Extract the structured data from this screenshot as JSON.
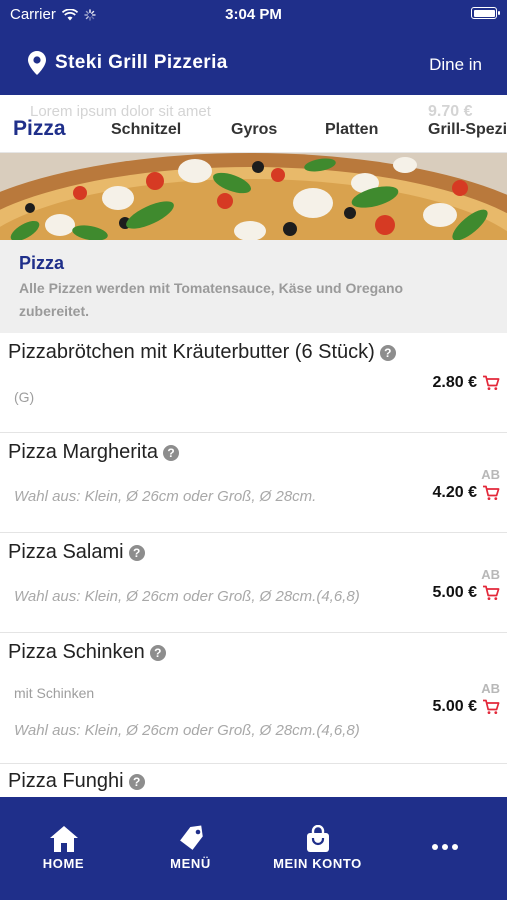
{
  "status_bar": {
    "carrier": "Carrier",
    "time": "3:04 PM"
  },
  "header": {
    "title": "Steki Grill Pizzeria",
    "mode": "Dine in"
  },
  "tabs": {
    "ghost_text": "Lorem ipsum dolor sit amet",
    "ghost_price": "9.70 €",
    "items": [
      {
        "label": "Pizza",
        "active": true
      },
      {
        "label": "Schnitzel"
      },
      {
        "label": "Gyros"
      },
      {
        "label": "Platten"
      },
      {
        "label": "Grill-Spezi"
      }
    ]
  },
  "category": {
    "title": "Pizza",
    "description": "Alle Pizzen werden mit Tomatensauce, Käse und Oregano zubereitet."
  },
  "items": [
    {
      "name": "Pizzabrötchen mit Kräuterbutter (6 Stück)",
      "sub": "(G)",
      "note": "",
      "ab": "",
      "price": "2.80 €"
    },
    {
      "name": "Pizza Margherita",
      "sub": "",
      "note": "Wahl aus: Klein, Ø 26cm oder Groß, Ø 28cm.",
      "ab": "AB",
      "price": "4.20 €"
    },
    {
      "name": "Pizza Salami",
      "sub": "",
      "note": "Wahl aus: Klein, Ø 26cm oder Groß, Ø 28cm.(4,6,8)",
      "ab": "AB",
      "price": "5.00 €"
    },
    {
      "name": "Pizza Schinken",
      "sub": "mit Schinken",
      "note": "Wahl aus: Klein, Ø 26cm oder Groß, Ø 28cm.(4,6,8)",
      "ab": "AB",
      "price": "5.00 €"
    },
    {
      "name": "Pizza Funghi",
      "sub": "",
      "note": "",
      "ab": "",
      "price": ""
    }
  ],
  "bottom_nav": [
    {
      "label": "HOME",
      "icon": "home-icon"
    },
    {
      "label": "MENÜ",
      "icon": "tag-icon"
    },
    {
      "label": "MEIN KONTO",
      "icon": "shopping-bag-icon"
    },
    {
      "label": "",
      "icon": "more-icon"
    }
  ],
  "colors": {
    "brand": "#1f2f8a",
    "cart": "#e3283a",
    "category_bg": "#efefef"
  }
}
